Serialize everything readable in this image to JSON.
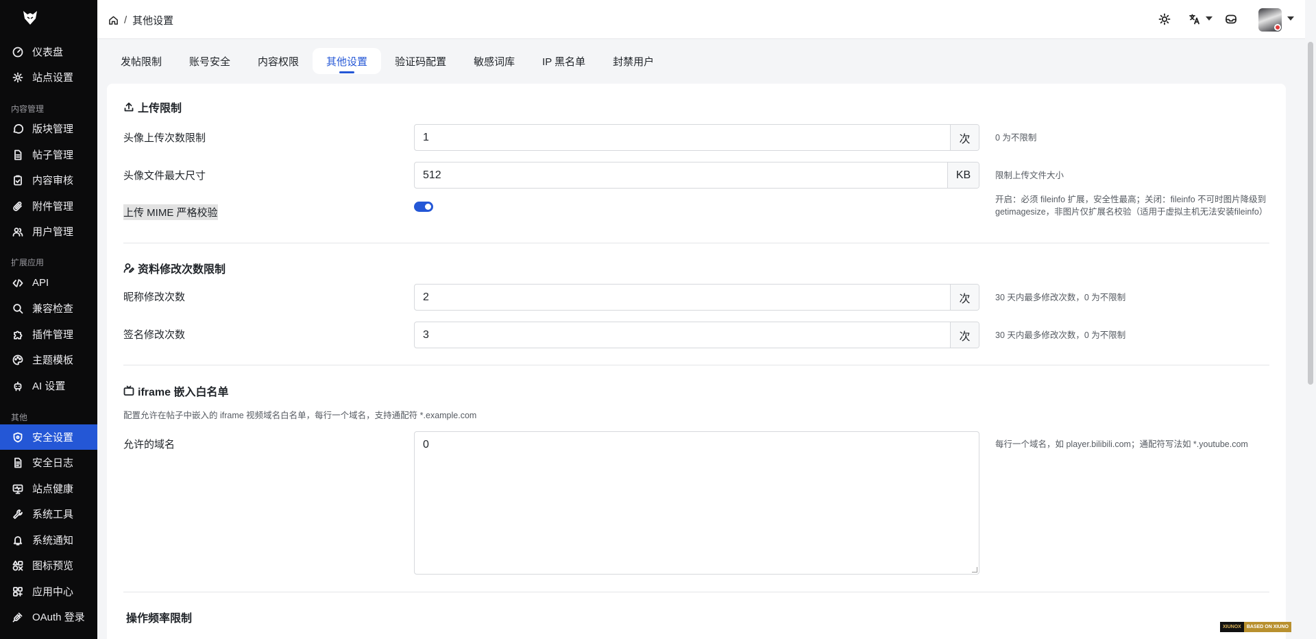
{
  "sidebar": {
    "items": [
      {
        "label": "仪表盘",
        "icon": "dashboard-icon"
      },
      {
        "label": "站点设置",
        "icon": "gear-icon"
      },
      {
        "label": "版块管理",
        "icon": "chat-bubble-icon"
      },
      {
        "label": "帖子管理",
        "icon": "document-icon"
      },
      {
        "label": "内容审核",
        "icon": "clipboard-check-icon"
      },
      {
        "label": "附件管理",
        "icon": "paperclip-icon"
      },
      {
        "label": "用户管理",
        "icon": "users-icon"
      },
      {
        "label": "API",
        "icon": "code-icon"
      },
      {
        "label": "兼容检查",
        "icon": "search-icon"
      },
      {
        "label": "插件管理",
        "icon": "puzzle-icon"
      },
      {
        "label": "主题模板",
        "icon": "palette-icon"
      },
      {
        "label": "AI 设置",
        "icon": "robot-icon"
      },
      {
        "label": "安全设置",
        "icon": "shield-icon"
      },
      {
        "label": "安全日志",
        "icon": "log-icon"
      },
      {
        "label": "站点健康",
        "icon": "monitor-icon"
      },
      {
        "label": "系统工具",
        "icon": "wrench-icon"
      },
      {
        "label": "系统通知",
        "icon": "bell-icon"
      },
      {
        "label": "图标预览",
        "icon": "shapes-icon"
      },
      {
        "label": "应用中心",
        "icon": "apps-icon"
      },
      {
        "label": "OAuth 登录",
        "icon": "plug-icon"
      }
    ],
    "groups": {
      "content": "内容管理",
      "extensions": "扩展应用",
      "other": "其他"
    },
    "active_index": 12
  },
  "breadcrumb": {
    "current": "其他设置"
  },
  "tabs": [
    {
      "label": "发帖限制"
    },
    {
      "label": "账号安全"
    },
    {
      "label": "内容权限"
    },
    {
      "label": "其他设置"
    },
    {
      "label": "验证码配置"
    },
    {
      "label": "敏感词库"
    },
    {
      "label": "IP 黑名单"
    },
    {
      "label": "封禁用户"
    }
  ],
  "active_tab": 3,
  "upload": {
    "title": "上传限制",
    "avatar_count_label": "头像上传次数限制",
    "avatar_count_value": "1",
    "avatar_count_unit": "次",
    "avatar_count_help": "0 为不限制",
    "avatar_size_label": "头像文件最大尺寸",
    "avatar_size_value": "512",
    "avatar_size_unit": "KB",
    "avatar_size_help": "限制上传文件大小",
    "mime_label": "上传 MIME 严格校验",
    "mime_enabled": true,
    "mime_help": "开启：必须 fileinfo 扩展，安全性最高；关闭：fileinfo 不可时图片降级到 getimagesize，非图片仅扩展名校验（适用于虚拟主机无法安装fileinfo）"
  },
  "profile": {
    "title": "资料修改次数限制",
    "nickname_label": "昵称修改次数",
    "nickname_value": "2",
    "nickname_unit": "次",
    "nickname_help": "30 天内最多修改次数，0 为不限制",
    "signature_label": "签名修改次数",
    "signature_value": "3",
    "signature_unit": "次",
    "signature_help": "30 天内最多修改次数，0 为不限制"
  },
  "iframe": {
    "title": "iframe 嵌入白名单",
    "description": "配置允许在帖子中嵌入的 iframe 视频域名白名单，每行一个域名，支持通配符 *.example.com",
    "domains_label": "允许的域名",
    "domains_value": "0",
    "domains_help": "每行一个域名，如 player.bilibili.com；通配符写法如 *.youtube.com"
  },
  "rate": {
    "title": "操作频率限制"
  },
  "footer": {
    "badge_left": "XIUNOX",
    "badge_right": "BASED ON XIUNO"
  }
}
